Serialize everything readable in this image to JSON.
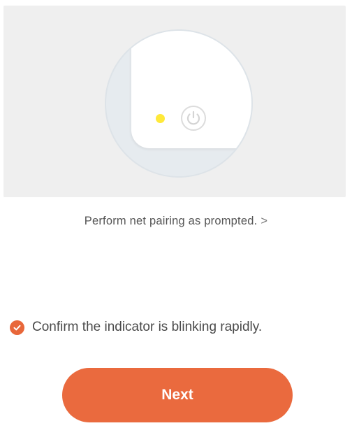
{
  "illustration": {
    "led_color": "#ffe93a",
    "icon": "power-icon"
  },
  "pairing": {
    "link_text": "Perform net pairing as prompted.",
    "chevron": ">"
  },
  "confirm": {
    "checked": true,
    "label": "Confirm the indicator is blinking rapidly.",
    "icon": "check-circle-icon",
    "accent": "#e8673a"
  },
  "actions": {
    "next_label": "Next",
    "button_color": "#ea6a3e"
  }
}
